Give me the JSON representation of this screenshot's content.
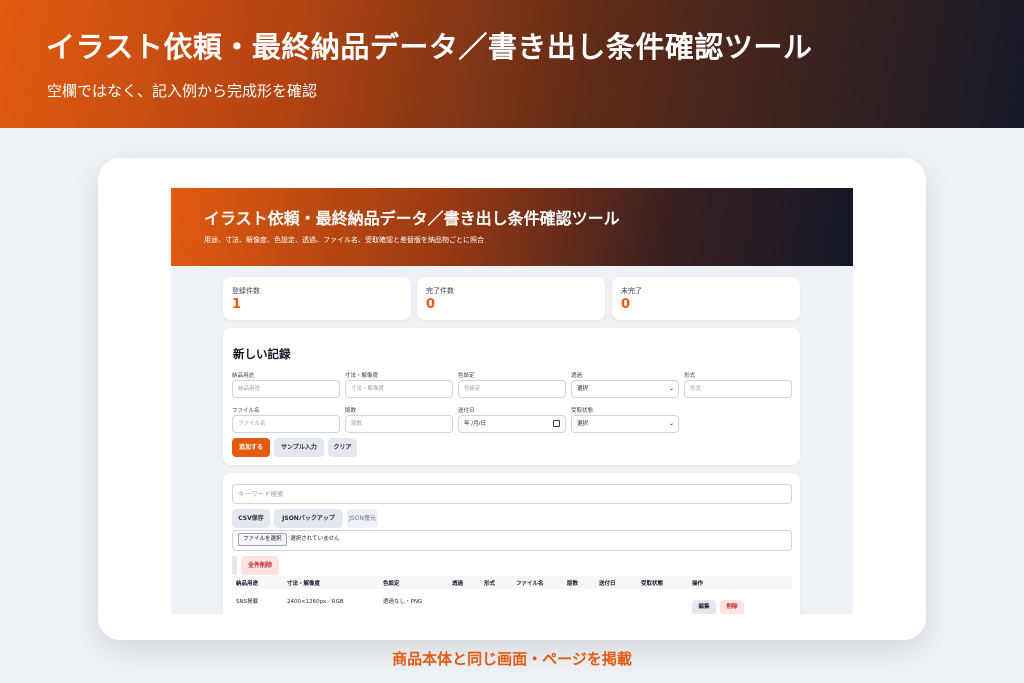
{
  "hero": {
    "title": "イラスト依頼・最終納品データ／書き出し条件確認ツール",
    "subtitle": "空欄ではなく、記入例から完成形を確認"
  },
  "app": {
    "title": "イラスト依頼・最終納品データ／書き出し条件確認ツール",
    "subtitle": "用途、寸法、解像度、色設定、透過、ファイル名、受取確認と差替版を納品物ごとに照合"
  },
  "stats": [
    {
      "label": "登録件数",
      "value": "1"
    },
    {
      "label": "完了件数",
      "value": "0"
    },
    {
      "label": "未完了",
      "value": "0"
    }
  ],
  "form": {
    "title": "新しい記録",
    "fields": [
      {
        "label": "納品用途",
        "placeholder": "納品用途"
      },
      {
        "label": "寸法・解像度",
        "placeholder": "寸法・解像度"
      },
      {
        "label": "色設定",
        "placeholder": "色設定"
      },
      {
        "label": "透過",
        "value": "選択"
      },
      {
        "label": "形式",
        "placeholder": "形式"
      },
      {
        "label": "ファイル名",
        "placeholder": "ファイル名"
      },
      {
        "label": "版数",
        "placeholder": "版数"
      },
      {
        "label": "送付日",
        "value": "年 /月/日"
      },
      {
        "label": "受取状態",
        "value": "選択"
      }
    ],
    "buttons": {
      "add": "追加する",
      "sample": "サンプル入力",
      "clear": "クリア"
    }
  },
  "list": {
    "search_placeholder": "キーワード検索",
    "csv_button": "CSV保存",
    "json_backup_button": "JSONバックアップ",
    "json_restore_button": "JSON復元",
    "file_button": "ファイルを選択",
    "file_status": "選択されていません",
    "delete_all_button": "全件削除",
    "columns": [
      "納品用途",
      "寸法・解像度",
      "色設定",
      "透過",
      "形式",
      "ファイル名",
      "版数",
      "送付日",
      "受取状態",
      "操作"
    ],
    "rows": [
      {
        "cells": [
          "SNS掲載",
          "2400×1260px／RGB",
          "透過なし・PNG",
          "",
          "",
          "",
          "",
          "",
          ""
        ],
        "edit": "編集",
        "delete": "削除"
      }
    ]
  },
  "caption": "商品本体と同じ画面・ページを掲載",
  "colors": {
    "accent": "#e25b10",
    "dark": "#161a28",
    "danger": "#c0262d"
  }
}
